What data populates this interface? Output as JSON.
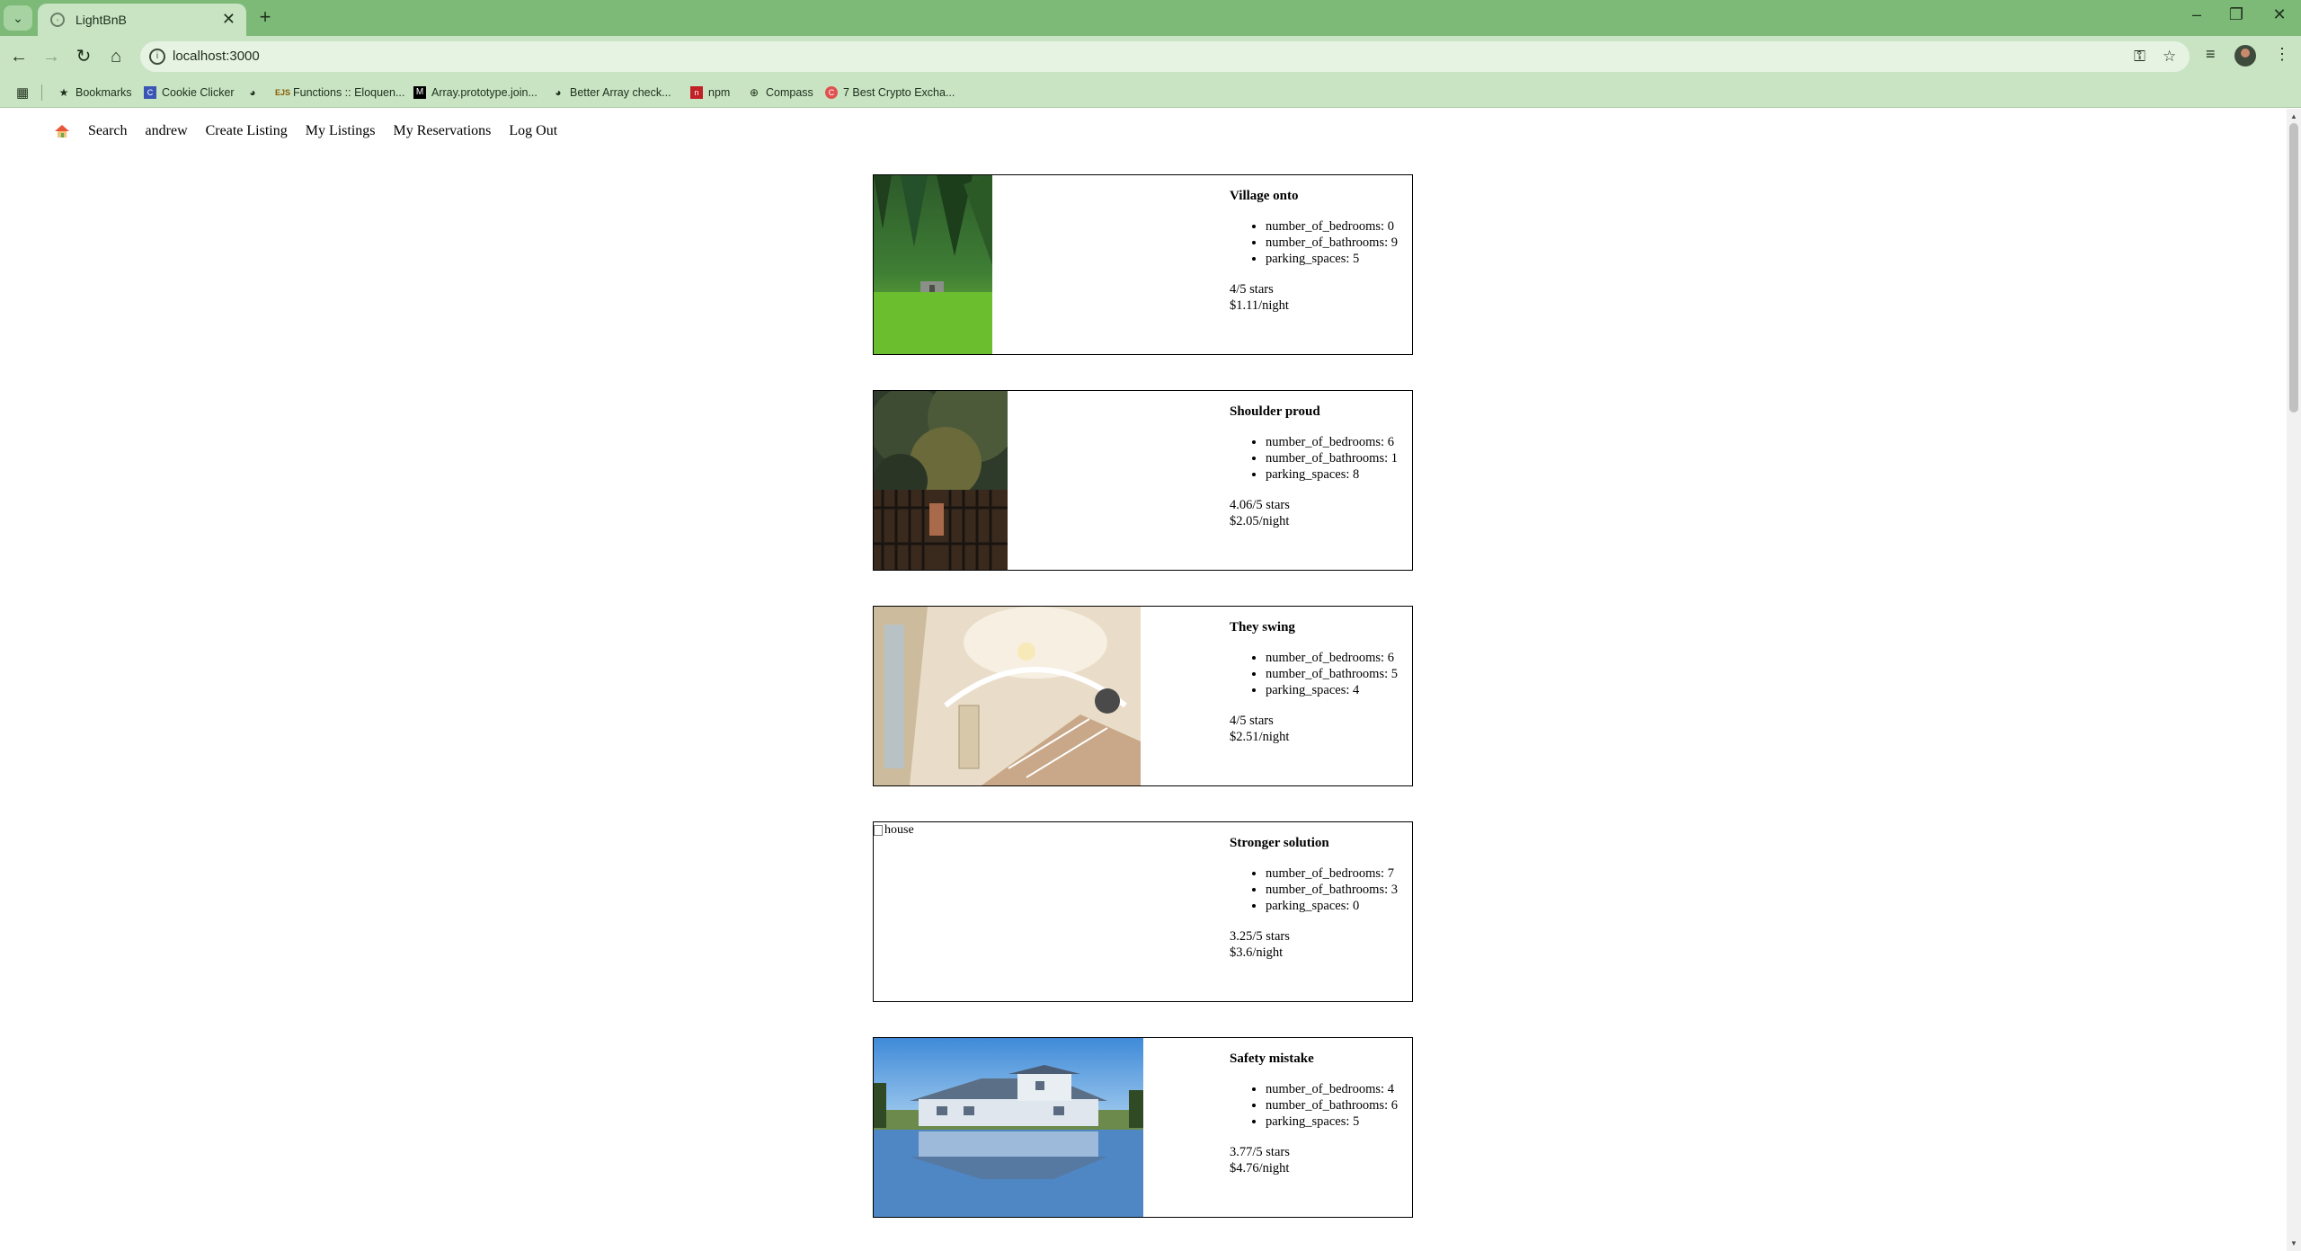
{
  "browser": {
    "tab_title": "LightBnB",
    "url": "localhost:3000",
    "bookmarks": [
      {
        "label": "Bookmarks",
        "icon": "star-icon"
      },
      {
        "label": "Cookie Clicker",
        "icon": "cookie-clicker-favicon"
      },
      {
        "label": "",
        "icon": "globe-icon"
      },
      {
        "label": "Functions :: Eloquen...",
        "icon": "eloquent-js-favicon"
      },
      {
        "label": "Array.prototype.join...",
        "icon": "mdn-favicon"
      },
      {
        "label": "Better Array check...",
        "icon": "globe-icon"
      },
      {
        "label": "npm",
        "icon": "npm-favicon"
      },
      {
        "label": "Compass",
        "icon": "compass-icon"
      },
      {
        "label": "7 Best Crypto Excha...",
        "icon": "crypto-favicon"
      }
    ]
  },
  "nav": {
    "links": [
      "Search",
      "andrew",
      "Create Listing",
      "My Listings",
      "My Reservations",
      "Log Out"
    ]
  },
  "listings": [
    {
      "title": "Village onto",
      "details": [
        "number_of_bedrooms: 0",
        "number_of_bathrooms: 9",
        "parking_spaces: 5"
      ],
      "rating": "4/5 stars",
      "price": "$1.11/night",
      "image": "forest-meadow",
      "image_alt": ""
    },
    {
      "title": "Shoulder proud",
      "details": [
        "number_of_bedrooms: 6",
        "number_of_bathrooms: 1",
        "parking_spaces: 8"
      ],
      "rating": "4.06/5 stars",
      "price": "$2.05/night",
      "image": "iron-gate-tree",
      "image_alt": ""
    },
    {
      "title": "They swing",
      "details": [
        "number_of_bedrooms: 6",
        "number_of_bathrooms: 5",
        "parking_spaces: 4"
      ],
      "rating": "4/5 stars",
      "price": "$2.51/night",
      "image": "spiral-staircase",
      "image_alt": ""
    },
    {
      "title": "Stronger solution",
      "details": [
        "number_of_bedrooms: 7",
        "number_of_bathrooms: 3",
        "parking_spaces: 0"
      ],
      "rating": "3.25/5 stars",
      "price": "$3.6/night",
      "image": "broken",
      "image_alt": "house"
    },
    {
      "title": "Safety mistake",
      "details": [
        "number_of_bedrooms: 4",
        "number_of_bathrooms: 6",
        "parking_spaces: 5"
      ],
      "rating": "3.77/5 stars",
      "price": "$4.76/night",
      "image": "lake-house",
      "image_alt": ""
    }
  ],
  "colors": {
    "chrome_dark": "#7dba78",
    "chrome_light": "#c8e4c3",
    "page_bg": "#ffffff",
    "card_border": "#000000"
  }
}
